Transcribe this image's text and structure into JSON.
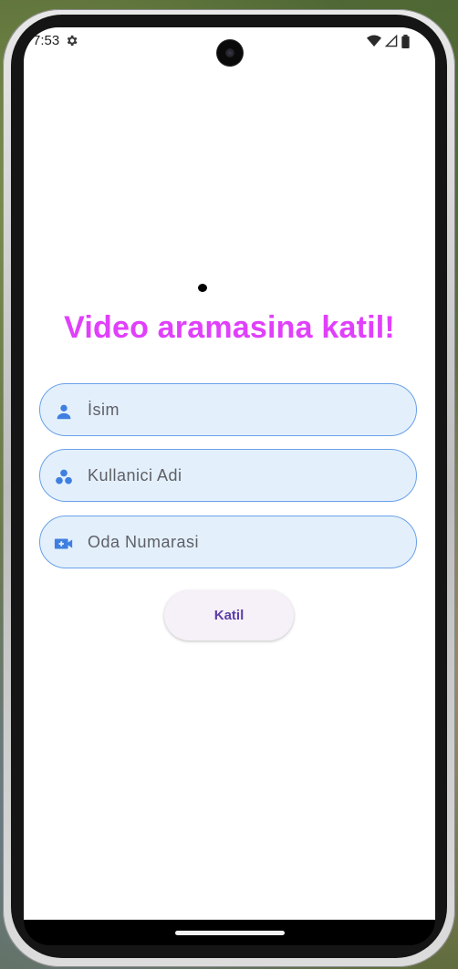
{
  "status_bar": {
    "time": "7:53",
    "icons": [
      "gear-icon",
      "wifi-icon",
      "cell-signal-icon",
      "battery-icon"
    ]
  },
  "page": {
    "title": "Video aramasina katil!"
  },
  "form": {
    "fields": [
      {
        "icon": "person-icon",
        "placeholder": "İsim",
        "value": ""
      },
      {
        "icon": "group-icon",
        "placeholder": "Kullanici Adi",
        "value": ""
      },
      {
        "icon": "video-call-icon",
        "placeholder": "Oda Numarasi",
        "value": ""
      }
    ],
    "join_label": "Katil"
  },
  "colors": {
    "title": "#e040fb",
    "field_background": "#e3f0fc",
    "field_border": "#6aa0e8",
    "icon": "#3f7fe0",
    "button_text": "#5b3ea8",
    "button_background": "#f6f0f8"
  }
}
